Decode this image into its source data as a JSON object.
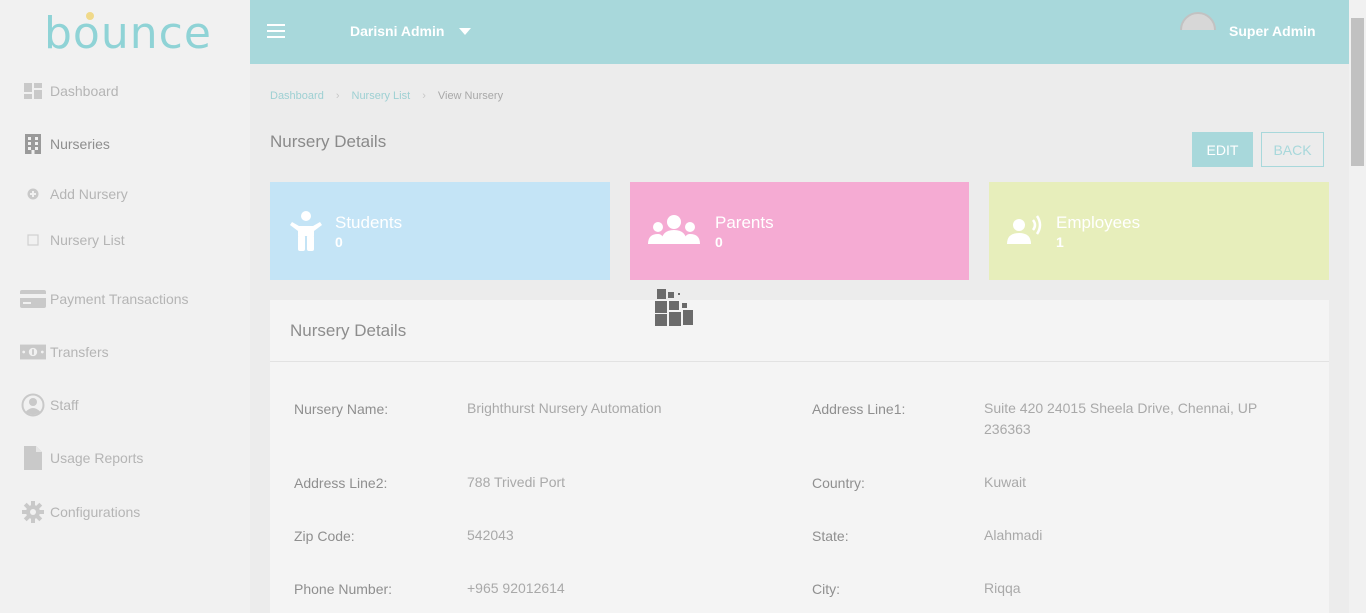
{
  "app": {
    "logo_text": "bounce"
  },
  "sidebar": {
    "items": [
      {
        "label": "Dashboard",
        "icon": "dashboard-icon"
      },
      {
        "label": "Nurseries",
        "icon": "building-icon"
      },
      {
        "label": "Add Nursery",
        "icon": "plus-circle-icon"
      },
      {
        "label": "Nursery List",
        "icon": "square-icon"
      },
      {
        "label": "Payment Transactions",
        "icon": "credit-card-icon"
      },
      {
        "label": "Transfers",
        "icon": "money-icon"
      },
      {
        "label": "Staff",
        "icon": "user-circle-icon"
      },
      {
        "label": "Usage Reports",
        "icon": "file-icon"
      },
      {
        "label": "Configurations",
        "icon": "gear-icon"
      }
    ]
  },
  "header": {
    "account": "Darisni Admin",
    "user_role": "Super Admin"
  },
  "breadcrumb": {
    "items": [
      "Dashboard",
      "Nursery List"
    ],
    "current": "View Nursery"
  },
  "page": {
    "title": "Nursery Details",
    "edit_label": "EDIT",
    "back_label": "BACK"
  },
  "cards": [
    {
      "title": "Students",
      "value": "0",
      "color": "#c4e4f6",
      "icon": "child-icon"
    },
    {
      "title": "Parents",
      "value": "0",
      "color": "#f5abd3",
      "icon": "users-icon"
    },
    {
      "title": "Employees",
      "value": "1",
      "color": "#e7eebb",
      "icon": "speaker-person-icon"
    }
  ],
  "details": {
    "heading": "Nursery Details",
    "fields": [
      {
        "label": "Nursery Name:",
        "value": "Brighthurst Nursery Automation"
      },
      {
        "label": "Address Line1:",
        "value": "Suite 420 24015 Sheela Drive, Chennai, UP 236363"
      },
      {
        "label": "Address Line2:",
        "value": "788 Trivedi Port"
      },
      {
        "label": "Country:",
        "value": "Kuwait"
      },
      {
        "label": "Zip Code:",
        "value": "542043"
      },
      {
        "label": "State:",
        "value": "Alahmadi"
      },
      {
        "label": "Phone Number:",
        "value": "+965 92012614"
      },
      {
        "label": "City:",
        "value": "Riqqa"
      }
    ]
  },
  "colors": {
    "accent": "#a8d8db",
    "sidebar_bg": "#f1f1f1",
    "content_bg": "#ececec"
  }
}
